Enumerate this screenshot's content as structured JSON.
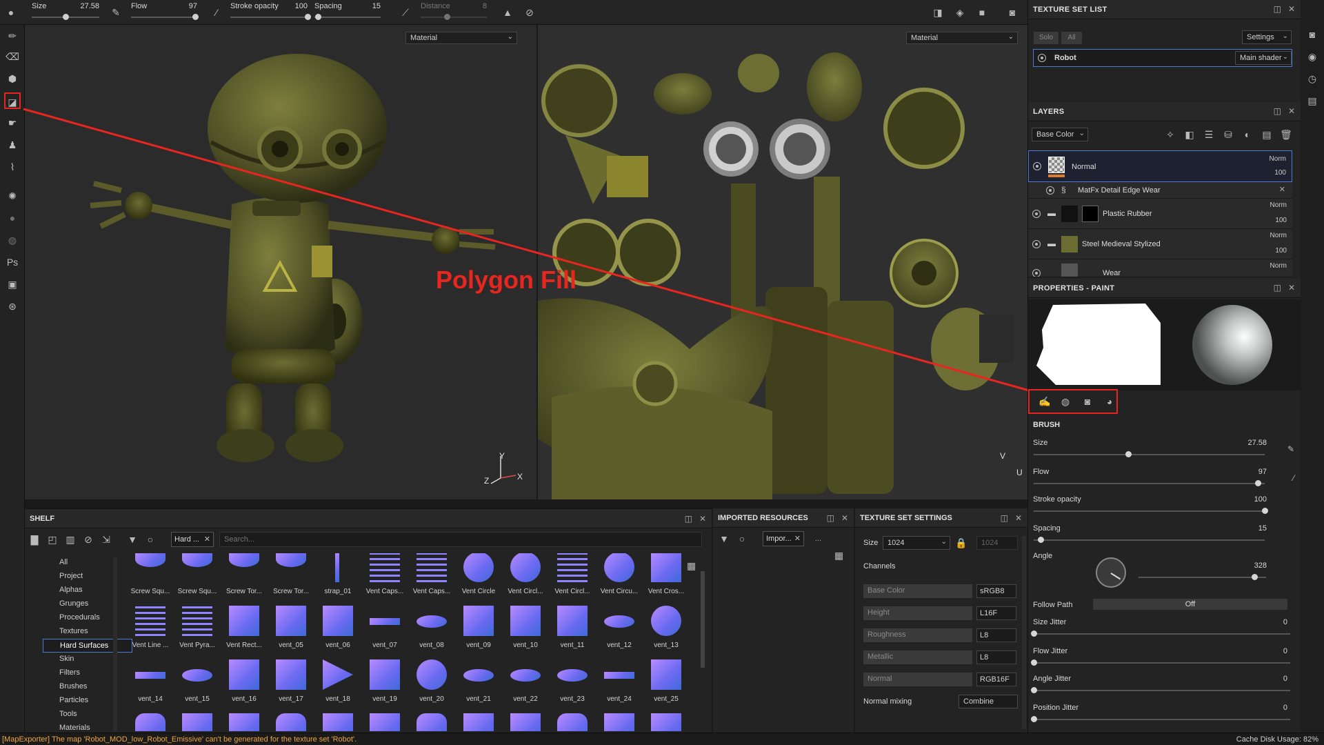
{
  "toolbar": {
    "size_label": "Size",
    "size_value": "27.58",
    "size_fill": 0.5,
    "flow_label": "Flow",
    "flow_value": "97",
    "flow_fill": 0.97,
    "stroke_label": "Stroke opacity",
    "stroke_value": "100",
    "stroke_fill": 1.0,
    "spacing_label": "Spacing",
    "spacing_value": "15",
    "spacing_fill": 0.05,
    "distance_label": "Distance",
    "distance_value": "8",
    "distance_fill": 0.4
  },
  "viewport3d": {
    "material_dropdown": "Material",
    "axis_y": "Y",
    "axis_x": "X",
    "axis_z": "Z"
  },
  "viewport2d": {
    "material_dropdown": "Material",
    "axis_v": "V",
    "axis_u": "U"
  },
  "annotation": {
    "label": "Polygon Fill",
    "color": "#e8261f"
  },
  "texture_set_list": {
    "title": "TEXTURE SET LIST",
    "solo": "Solo",
    "all": "All",
    "settings": "Settings",
    "set_name": "Robot",
    "shader": "Main shader"
  },
  "layers": {
    "title": "LAYERS",
    "channel_dropdown": "Base Color",
    "rows": [
      {
        "name": "Normal",
        "blend": "Norm",
        "opacity": "100"
      },
      {
        "name": "MatFx Detail Edge Wear"
      },
      {
        "name": "Plastic Rubber",
        "blend": "Norm",
        "opacity": "100"
      },
      {
        "name": "Steel Medieval Stylized",
        "blend": "Norm",
        "opacity": "100"
      },
      {
        "name": "Wear",
        "blend": "Norm"
      }
    ]
  },
  "properties": {
    "title": "PROPERTIES - PAINT",
    "brush_section": "BRUSH",
    "size_label": "Size",
    "size_value": "27.58",
    "size_fill": 0.41,
    "flow_label": "Flow",
    "flow_value": "97",
    "flow_fill": 0.97,
    "stroke_label": "Stroke opacity",
    "stroke_value": "100",
    "stroke_fill": 1.0,
    "spacing_label": "Spacing",
    "spacing_value": "15",
    "spacing_fill": 0.03,
    "angle_label": "Angle",
    "angle_value": "328",
    "angle_fill": 0.91,
    "follow_path_label": "Follow Path",
    "follow_path_value": "Off",
    "size_jitter_label": "Size Jitter",
    "size_jitter_value": "0",
    "flow_jitter_label": "Flow Jitter",
    "flow_jitter_value": "0",
    "angle_jitter_label": "Angle Jitter",
    "angle_jitter_value": "0",
    "position_jitter_label": "Position Jitter",
    "position_jitter_value": "0"
  },
  "shelf": {
    "title": "SHELF",
    "filter_tag": "Hard ...",
    "search_placeholder": "Search...",
    "categories": [
      "All",
      "Project",
      "Alphas",
      "Grunges",
      "Procedurals",
      "Textures",
      "Hard Surfaces",
      "Skin",
      "Filters",
      "Brushes",
      "Particles",
      "Tools",
      "Materials"
    ],
    "selected_category": "Hard Surfaces",
    "items": [
      "Screw Squ...",
      "Screw Squ...",
      "Screw Tor...",
      "Screw Tor...",
      "strap_01",
      "Vent Caps...",
      "Vent Caps...",
      "Vent Circle",
      "Vent Circl...",
      "Vent Circl...",
      "Vent Circu...",
      "Vent Cros...",
      "Vent Line ...",
      "Vent Pyra...",
      "Vent Rect...",
      "vent_05",
      "vent_06",
      "vent_07",
      "vent_08",
      "vent_09",
      "vent_10",
      "vent_11",
      "vent_12",
      "vent_13",
      "vent_14",
      "vent_15",
      "vent_16",
      "vent_17",
      "vent_18",
      "vent_19",
      "vent_20",
      "vent_21",
      "vent_22",
      "vent_23",
      "vent_24",
      "vent_25"
    ]
  },
  "imported": {
    "title": "IMPORTED RESOURCES",
    "filter_tag": "Impor...",
    "search": "..."
  },
  "tss": {
    "title": "TEXTURE SET SETTINGS",
    "size_label": "Size",
    "size_value": "1024",
    "size_locked": "1024",
    "channels_label": "Channels",
    "channels": [
      {
        "name": "Base Color",
        "fmt": "sRGB8"
      },
      {
        "name": "Height",
        "fmt": "L16F"
      },
      {
        "name": "Roughness",
        "fmt": "L8"
      },
      {
        "name": "Metallic",
        "fmt": "L8"
      },
      {
        "name": "Normal",
        "fmt": "RGB16F"
      }
    ],
    "normal_mixing_label": "Normal mixing",
    "normal_mixing_value": "Combine"
  },
  "status": {
    "message": "[MapExporter] The map 'Robot_MOD_low_Robot_Emissive' can't be generated for the texture set 'Robot'.",
    "cache_label": "Cache Disk Usage:",
    "cache_value": "82%"
  }
}
